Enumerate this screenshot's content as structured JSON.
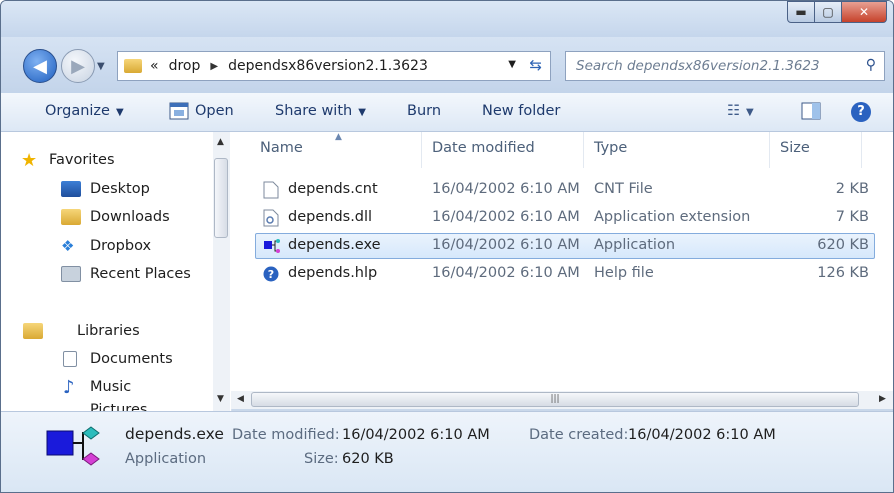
{
  "window": {
    "controls": {
      "minimize": "▬",
      "maximize": "▢",
      "close": "✕"
    }
  },
  "navbar": {
    "back_glyph": "◀",
    "forward_glyph": "▶",
    "breadcrumb_overflow": "«",
    "breadcrumbs": [
      "drop",
      "dependsx86version2.1.3623"
    ],
    "search_placeholder": "Search dependsx86version2.1.3623"
  },
  "toolbar": {
    "organize": "Organize",
    "open": "Open",
    "share_with": "Share with",
    "burn": "Burn",
    "new_folder": "New folder"
  },
  "sidebar": {
    "favorites_header": "Favorites",
    "favorites": [
      "Desktop",
      "Downloads",
      "Dropbox",
      "Recent Places"
    ],
    "libraries_header": "Libraries",
    "libraries": [
      "Documents",
      "Music",
      "Pictures"
    ]
  },
  "columns": {
    "name": "Name",
    "date": "Date modified",
    "type": "Type",
    "size": "Size"
  },
  "files": [
    {
      "name": "depends.cnt",
      "date": "16/04/2002 6:10 AM",
      "type": "CNT File",
      "size": "2 KB",
      "icon": "document-icon"
    },
    {
      "name": "depends.dll",
      "date": "16/04/2002 6:10 AM",
      "type": "Application extension",
      "size": "7 KB",
      "icon": "dll-icon"
    },
    {
      "name": "depends.exe",
      "date": "16/04/2002 6:10 AM",
      "type": "Application",
      "size": "620 KB",
      "icon": "exe-icon",
      "selected": true
    },
    {
      "name": "depends.hlp",
      "date": "16/04/2002 6:10 AM",
      "type": "Help file",
      "size": "126 KB",
      "icon": "help-file-icon"
    }
  ],
  "details": {
    "name": "depends.exe",
    "type": "Application",
    "date_modified_label": "Date modified:",
    "date_modified": "16/04/2002 6:10 AM",
    "date_created_label": "Date created:",
    "date_created": "16/04/2002 6:10 AM",
    "size_label": "Size:",
    "size": "620 KB"
  },
  "colors": {
    "accent": "#2a62c0",
    "selection": "#d6e8fb"
  }
}
